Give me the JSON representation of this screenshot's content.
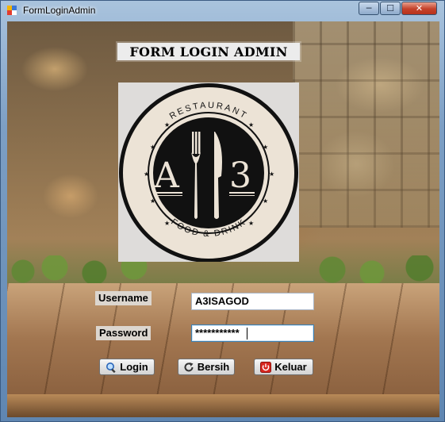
{
  "window": {
    "title": "FormLoginAdmin",
    "controls": {
      "minimize": "─",
      "maximize": "☐",
      "close": "✕"
    }
  },
  "form": {
    "heading": "FORM LOGIN ADMIN",
    "logo": {
      "top_text": "RESTAURANT",
      "bottom_text": "FOOD & DRINK",
      "left_letter": "A",
      "right_letter": "3"
    },
    "username": {
      "label": "Username",
      "value": "A3ISAGOD"
    },
    "password": {
      "label": "Password",
      "value": "***********"
    },
    "buttons": {
      "login": {
        "label": "Login",
        "icon": "magnifier-icon"
      },
      "clear": {
        "label": "Bersih",
        "icon": "refresh-icon"
      },
      "exit": {
        "label": "Keluar",
        "icon": "power-icon"
      }
    }
  },
  "colors": {
    "title_bg": "#ececec",
    "close_button": "#c4412a",
    "logo_ring": "#111111",
    "logo_cream": "#ece3d6"
  }
}
